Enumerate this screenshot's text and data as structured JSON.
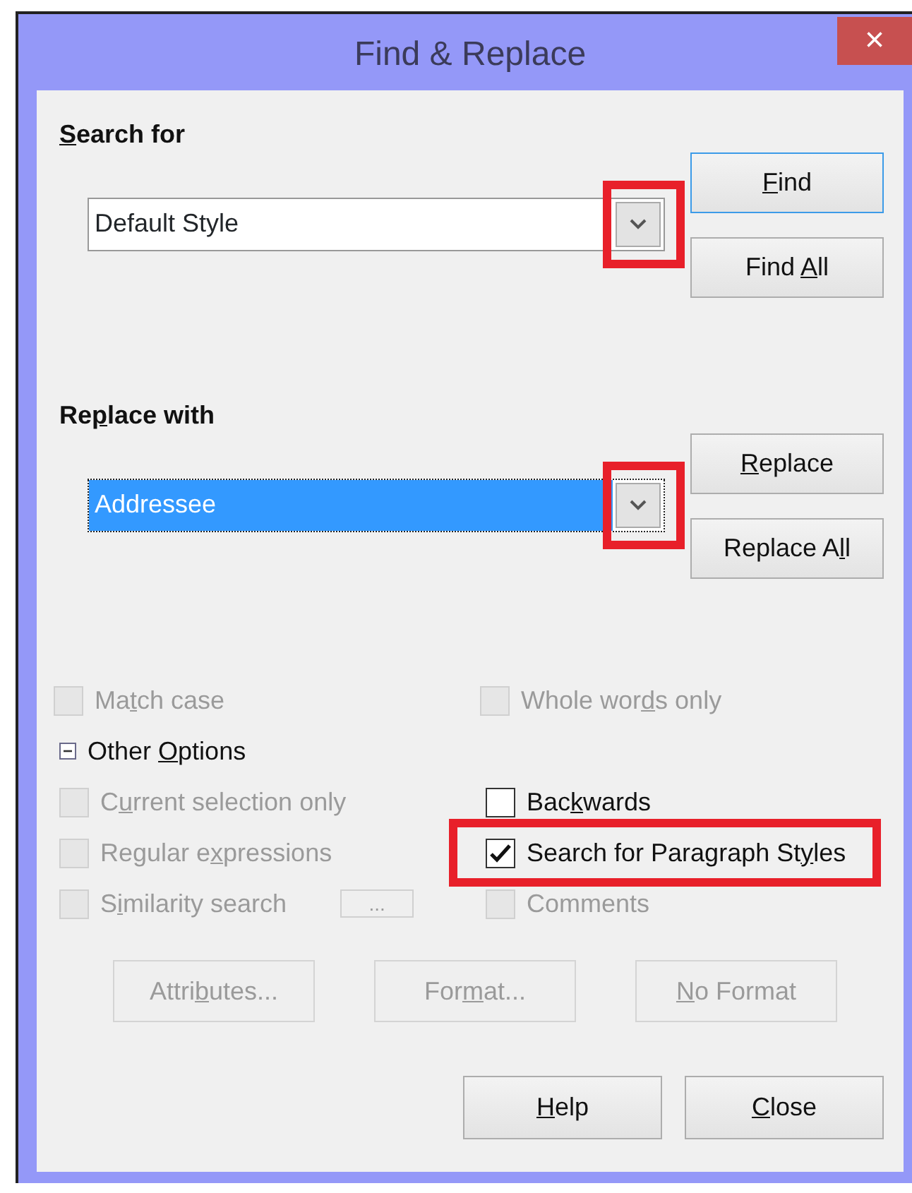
{
  "window": {
    "title": "Find & Replace",
    "close": "×"
  },
  "search": {
    "label": {
      "key": "S",
      "post": "earch for"
    },
    "combo": {
      "value": "Default Style",
      "selected": false,
      "highlighted": true
    },
    "buttons": [
      {
        "label": {
          "key": "F",
          "post": "ind"
        },
        "focused": true,
        "disabled": false
      },
      {
        "label": {
          "pre": "Find ",
          "key": "A",
          "post": "ll"
        },
        "focused": false,
        "disabled": false
      }
    ]
  },
  "replace": {
    "label": {
      "pre": "Re",
      "key": "p",
      "post": "lace with"
    },
    "combo": {
      "value": "Addressee",
      "selected": true,
      "highlighted": true
    },
    "buttons": [
      {
        "label": {
          "key": "R",
          "post": "eplace"
        },
        "focused": false,
        "disabled": false
      },
      {
        "label": {
          "pre": "Replace A",
          "key": "l",
          "post": "l"
        },
        "focused": false,
        "disabled": false
      }
    ]
  },
  "options": [
    {
      "label": {
        "pre": "Ma",
        "key": "t",
        "post": "ch case"
      },
      "checked": false,
      "disabled": true,
      "highlighted": false
    },
    {
      "label": {
        "pre": "Whole wor",
        "key": "d",
        "post": "s only"
      },
      "checked": false,
      "disabled": true,
      "highlighted": false
    }
  ],
  "other_options": {
    "label": {
      "pre": "Other ",
      "key": "O",
      "post": "ptions"
    },
    "expanded": true,
    "items": [
      {
        "label": {
          "pre": "C",
          "key": "u",
          "post": "rrent selection only"
        },
        "checked": false,
        "disabled": true,
        "highlighted": false
      },
      {
        "label": {
          "pre": "Bac",
          "key": "k",
          "post": "wards"
        },
        "checked": false,
        "disabled": false,
        "highlighted": false
      },
      {
        "label": {
          "pre": "Regular e",
          "key": "x",
          "post": "pressions"
        },
        "checked": false,
        "disabled": true,
        "highlighted": false
      },
      {
        "label": {
          "pre": "Search for Paragraph St",
          "key": "y",
          "post": "les"
        },
        "checked": true,
        "disabled": false,
        "highlighted": true
      },
      {
        "label": {
          "pre": "S",
          "key": "i",
          "post": "milarity search"
        },
        "checked": false,
        "disabled": true,
        "highlighted": false,
        "extra_button": "..."
      },
      {
        "label": {
          "pre": "Comments"
        },
        "checked": false,
        "disabled": true,
        "highlighted": false
      }
    ]
  },
  "format_buttons": [
    {
      "label": {
        "pre": "Attri",
        "key": "b",
        "post": "utes..."
      },
      "disabled": true
    },
    {
      "label": {
        "pre": "For",
        "key": "m",
        "post": "at..."
      },
      "disabled": true
    },
    {
      "label": {
        "key": "N",
        "post": "o Format"
      },
      "disabled": true
    }
  ],
  "footer_buttons": [
    {
      "label": {
        "key": "H",
        "post": "elp"
      },
      "disabled": false
    },
    {
      "label": {
        "key": "C",
        "post": "lose"
      },
      "disabled": false
    }
  ]
}
